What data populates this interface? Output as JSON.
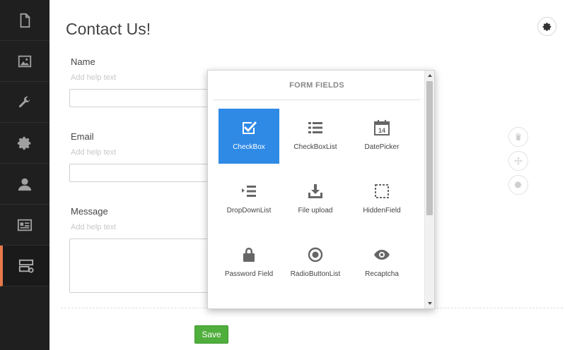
{
  "page": {
    "title": "Contact Us!"
  },
  "sidebar": {
    "items": [
      {
        "icon": "document-icon"
      },
      {
        "icon": "image-icon"
      },
      {
        "icon": "wrench-icon"
      },
      {
        "icon": "gear-icon"
      },
      {
        "icon": "user-icon"
      },
      {
        "icon": "contact-card-icon"
      },
      {
        "icon": "form-builder-icon",
        "active": true
      }
    ],
    "accent_color": "#e8794b"
  },
  "form": {
    "fields": [
      {
        "label": "Name",
        "help": "Add help text",
        "value": ""
      },
      {
        "label": "Email",
        "help": "Add help text",
        "value": ""
      },
      {
        "label": "Message",
        "help": "Add help text",
        "value": ""
      }
    ],
    "save_label": "Save",
    "save_color": "#4fae3c"
  },
  "popup": {
    "header": "FORM FIELDS",
    "selected_color": "#2f8ae6",
    "tiles": [
      {
        "label": "CheckBox",
        "icon": "checkbox-icon",
        "selected": true
      },
      {
        "label": "CheckBoxList",
        "icon": "list-icon"
      },
      {
        "label": "DatePicker",
        "icon": "calendar-icon",
        "calendar_day": "14"
      },
      {
        "label": "DropDownList",
        "icon": "dropdown-list-icon"
      },
      {
        "label": "File upload",
        "icon": "upload-icon"
      },
      {
        "label": "HiddenField",
        "icon": "dashed-square-icon"
      },
      {
        "label": "Password Field",
        "icon": "lock-icon"
      },
      {
        "label": "RadioButtonList",
        "icon": "radio-icon"
      },
      {
        "label": "Recaptcha",
        "icon": "eye-icon"
      }
    ]
  }
}
